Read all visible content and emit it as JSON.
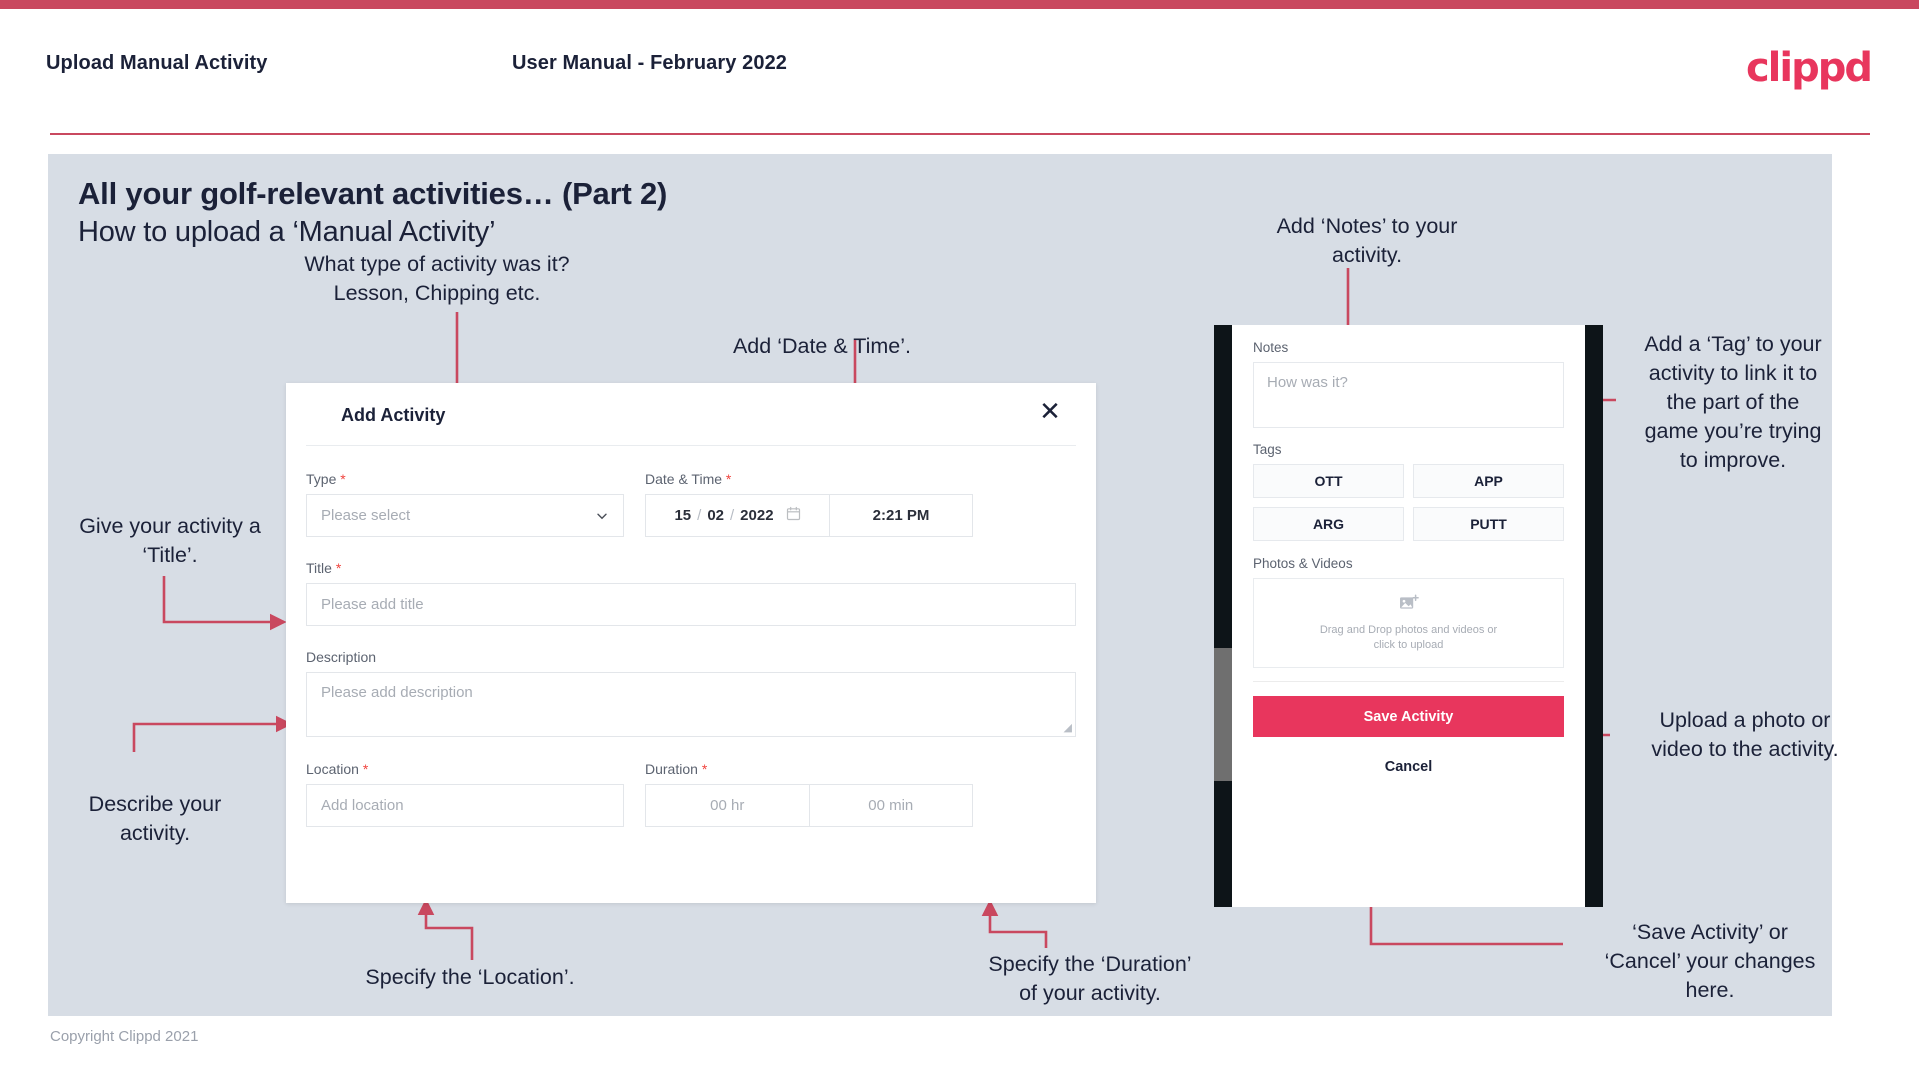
{
  "header": {
    "title": "Upload Manual Activity",
    "subtitle": "User Manual - February 2022",
    "logo": "clippd"
  },
  "slide": {
    "title": "All your golf-relevant activities… (Part 2)",
    "subtitle": "How to upload a ‘Manual Activity’"
  },
  "footer": {
    "copyright": "Copyright Clippd 2021"
  },
  "colors": {
    "brand_pink": "#e8365d",
    "top_bar": "#c9485f",
    "slide_bg": "#d7dde5",
    "arrow": "#c9485f",
    "text_dark": "#1b2138",
    "required": "#f0443e"
  },
  "dialog": {
    "title": "Add Activity",
    "close_icon": "close-icon",
    "fields": {
      "type": {
        "label": "Type",
        "required": "*",
        "placeholder": "Please select",
        "icon": "chevron-down-icon"
      },
      "datetime": {
        "label": "Date & Time",
        "required": "*",
        "day": "15",
        "month": "02",
        "year": "2022",
        "sep": "/",
        "time": "2:21 PM",
        "icon": "calendar-icon"
      },
      "title": {
        "label": "Title",
        "required": "*",
        "placeholder": "Please add title"
      },
      "description": {
        "label": "Description",
        "required": "",
        "placeholder": "Please add description"
      },
      "location": {
        "label": "Location",
        "required": "*",
        "placeholder": "Add location"
      },
      "duration": {
        "label": "Duration",
        "required": "*",
        "hours": "00 hr",
        "minutes": "00 min"
      }
    }
  },
  "phone": {
    "notes": {
      "label": "Notes",
      "placeholder": "How was it?"
    },
    "tags": {
      "label": "Tags",
      "items": [
        "OTT",
        "APP",
        "ARG",
        "PUTT"
      ]
    },
    "photos": {
      "label": "Photos & Videos",
      "icon": "add-image-icon",
      "drop_line1": "Drag and Drop photos and videos or",
      "drop_line2": "click to upload"
    },
    "save_label": "Save Activity",
    "cancel_label": "Cancel"
  },
  "annotations": {
    "type": "What type of activity was it?\nLesson, Chipping etc.",
    "type_l1": "What type of activity was it?",
    "type_l2": "Lesson, Chipping etc.",
    "datetime": "Add ‘Date & Time’.",
    "title": "Give your activity a\n‘Title’.",
    "title_l1": "Give your activity a",
    "title_l2": "‘Title’.",
    "description_l1": "Describe your",
    "description_l2": "activity.",
    "location": "Specify the ‘Location’.",
    "duration_l1": "Specify the ‘Duration’",
    "duration_l2": "of your activity.",
    "notes_l1": "Add ‘Notes’ to your",
    "notes_l2": "activity.",
    "tags_l1": "Add a ‘Tag’ to your",
    "tags_l2": "activity to link it to",
    "tags_l3": "the part of the",
    "tags_l4": "game you’re trying",
    "tags_l5": "to improve.",
    "upload_l1": "Upload a photo or",
    "upload_l2": "video to the activity.",
    "save_l1": "‘Save Activity’ or",
    "save_l2": "‘Cancel’ your changes",
    "save_l3": "here."
  }
}
